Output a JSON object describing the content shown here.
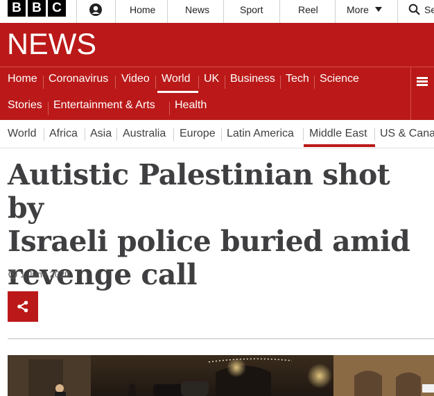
{
  "bbc_blocks": [
    "B",
    "B",
    "C"
  ],
  "top_nav": [
    "Home",
    "News",
    "Sport",
    "Reel",
    "More"
  ],
  "search_label": "Se",
  "logo": "NEWS",
  "main_nav_row1": [
    "Home",
    "Coronavirus",
    "Video",
    "World",
    "UK",
    "Business",
    "Tech",
    "Science"
  ],
  "main_nav_row2": [
    "Stories",
    "Entertainment & Arts",
    "Health"
  ],
  "sub_nav": [
    "World",
    "Africa",
    "Asia",
    "Australia",
    "Europe",
    "Latin America",
    "Middle East",
    "US & Cana"
  ],
  "article": {
    "headline_lines": [
      "Autistic Palestinian shot by",
      "Israeli police buried amid",
      "revenge call"
    ],
    "date": "1 June 2020"
  },
  "colors": {
    "brand_red": "#bb1919",
    "text_dark": "#3f3f42"
  },
  "icons": {
    "account": "account-icon",
    "search": "search-icon",
    "menu": "menu-icon",
    "clock": "clock-icon",
    "share": "share-icon"
  }
}
